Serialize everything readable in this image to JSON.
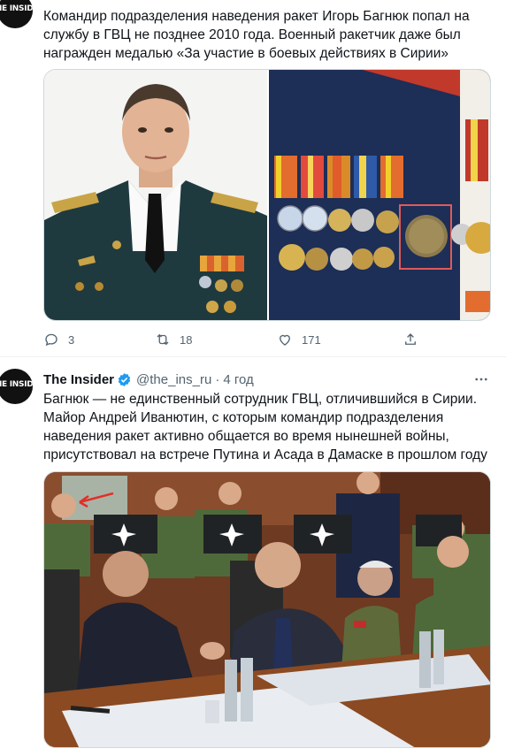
{
  "tweet1": {
    "avatar_text": "IE INSIDER",
    "text_lines": [
      "Командир подразделения наведения ракет Игорь Багнюк попал на",
      "службу в ГВЦ не позднее 2010 года. Военный ракетчик даже был",
      "награжден медалью «За участие в боевых действиях в Сирии»"
    ],
    "actions": {
      "reply_count": "3",
      "retweet_count": "18",
      "like_count": "171"
    }
  },
  "tweet2": {
    "avatar_text": "IE INSIDER",
    "author_name": "The Insider",
    "handle": "@the_ins_ru",
    "separator": "·",
    "time": "4 год",
    "text_lines": [
      "Багнюк — не единственный сотрудник ГВЦ, отличившийся в Сирии.",
      "Майор Андрей Иванютин, с которым командир подразделения",
      "наведения ракет активно общается во время нынешней войны,",
      "присутствовал на встрече Путина и Асада в Дамаске в прошлом году"
    ]
  },
  "colors": {
    "verified": "#1d9bf0",
    "secondary_text": "#536471",
    "border": "#cfd9de"
  },
  "icons": [
    "reply-icon",
    "retweet-icon",
    "like-icon",
    "share-icon",
    "verified-badge-icon",
    "more-options-icon"
  ]
}
